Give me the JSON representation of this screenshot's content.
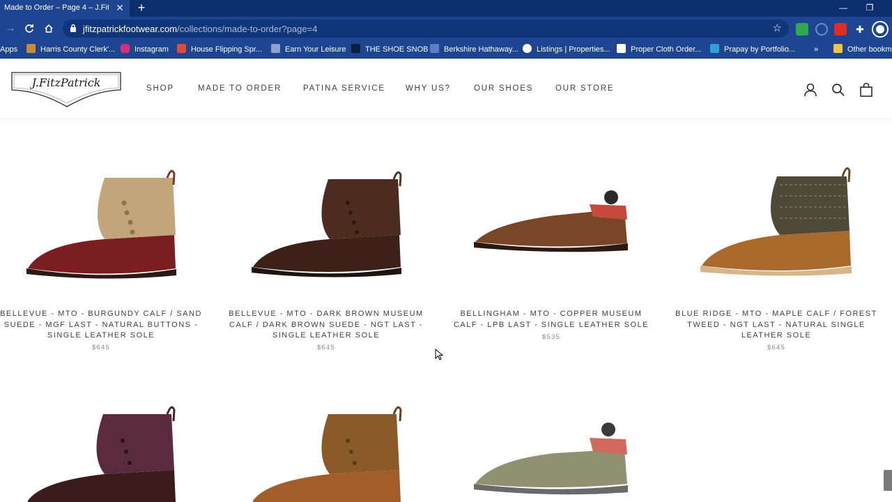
{
  "browser": {
    "tab_title": "Made to Order – Page 4 – J.FitzPatrick",
    "url_domain": "jfitzpatrickfootwear.com",
    "url_path": "/collections/made-to-order?page=4",
    "bookmarks": [
      "Apps",
      "Harris County Clerk'...",
      "Instagram",
      "House Flipping Spr...",
      "Earn Your Leisure",
      "THE SHOE SNOB",
      "Berkshire Hathaway...",
      "Listings | Properties...",
      "Proper Cloth Order...",
      "Prapay by Portfolio...",
      "»",
      "Other bookmarks"
    ]
  },
  "nav": {
    "items": [
      "SHOP",
      "MADE TO ORDER",
      "PATINA SERVICE",
      "WHY US?",
      "OUR SHOES",
      "OUR STORE"
    ]
  },
  "logo_text": "J.FitzPatrick",
  "products": [
    {
      "title": "BELLEVUE - MTO - BURGUNDY CALF / SAND SUEDE - MGF LAST - NATURAL BUTTONS - SINGLE LEATHER SOLE",
      "price": "$645"
    },
    {
      "title": "BELLEVUE - MTO - DARK BROWN MUSEUM CALF / DARK BROWN SUEDE - NGT LAST - SINGLE LEATHER SOLE",
      "price": "$645"
    },
    {
      "title": "BELLINGHAM - MTO - COPPER MUSEUM CALF - LPB LAST - SINGLE LEATHER SOLE",
      "price": "$535"
    },
    {
      "title": "BLUE RIDGE - MTO - MAPLE CALF / FOREST TWEED - NGT LAST - NATURAL SINGLE LEATHER SOLE",
      "price": "$645"
    }
  ],
  "colors": {
    "chrome_dark": "#0b2f6b",
    "chrome": "#1d4592",
    "text": "#3e3e3e",
    "price": "#8a8a8a"
  }
}
